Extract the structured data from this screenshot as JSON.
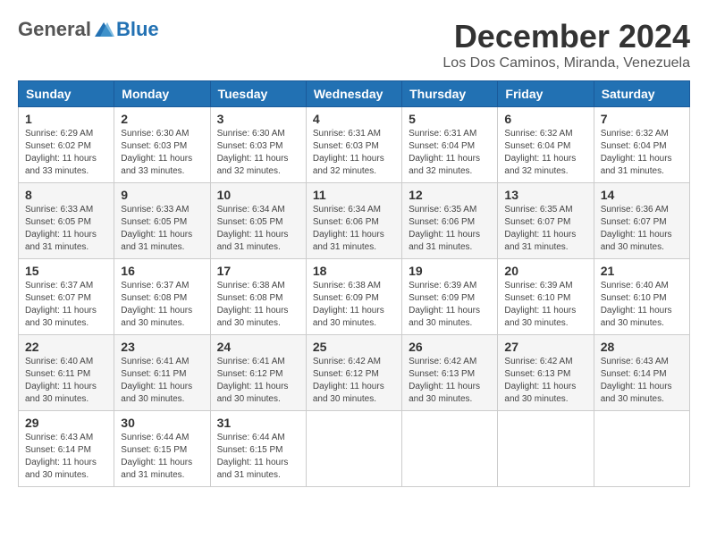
{
  "header": {
    "logo": {
      "general": "General",
      "blue": "Blue"
    },
    "title": "December 2024",
    "location": "Los Dos Caminos, Miranda, Venezuela"
  },
  "calendar": {
    "weekdays": [
      "Sunday",
      "Monday",
      "Tuesday",
      "Wednesday",
      "Thursday",
      "Friday",
      "Saturday"
    ],
    "weeks": [
      [
        {
          "day": "1",
          "sunrise": "6:29 AM",
          "sunset": "6:02 PM",
          "daylight": "11 hours and 33 minutes."
        },
        {
          "day": "2",
          "sunrise": "6:30 AM",
          "sunset": "6:03 PM",
          "daylight": "11 hours and 33 minutes."
        },
        {
          "day": "3",
          "sunrise": "6:30 AM",
          "sunset": "6:03 PM",
          "daylight": "11 hours and 32 minutes."
        },
        {
          "day": "4",
          "sunrise": "6:31 AM",
          "sunset": "6:03 PM",
          "daylight": "11 hours and 32 minutes."
        },
        {
          "day": "5",
          "sunrise": "6:31 AM",
          "sunset": "6:04 PM",
          "daylight": "11 hours and 32 minutes."
        },
        {
          "day": "6",
          "sunrise": "6:32 AM",
          "sunset": "6:04 PM",
          "daylight": "11 hours and 32 minutes."
        },
        {
          "day": "7",
          "sunrise": "6:32 AM",
          "sunset": "6:04 PM",
          "daylight": "11 hours and 31 minutes."
        }
      ],
      [
        {
          "day": "8",
          "sunrise": "6:33 AM",
          "sunset": "6:05 PM",
          "daylight": "11 hours and 31 minutes."
        },
        {
          "day": "9",
          "sunrise": "6:33 AM",
          "sunset": "6:05 PM",
          "daylight": "11 hours and 31 minutes."
        },
        {
          "day": "10",
          "sunrise": "6:34 AM",
          "sunset": "6:05 PM",
          "daylight": "11 hours and 31 minutes."
        },
        {
          "day": "11",
          "sunrise": "6:34 AM",
          "sunset": "6:06 PM",
          "daylight": "11 hours and 31 minutes."
        },
        {
          "day": "12",
          "sunrise": "6:35 AM",
          "sunset": "6:06 PM",
          "daylight": "11 hours and 31 minutes."
        },
        {
          "day": "13",
          "sunrise": "6:35 AM",
          "sunset": "6:07 PM",
          "daylight": "11 hours and 31 minutes."
        },
        {
          "day": "14",
          "sunrise": "6:36 AM",
          "sunset": "6:07 PM",
          "daylight": "11 hours and 30 minutes."
        }
      ],
      [
        {
          "day": "15",
          "sunrise": "6:37 AM",
          "sunset": "6:07 PM",
          "daylight": "11 hours and 30 minutes."
        },
        {
          "day": "16",
          "sunrise": "6:37 AM",
          "sunset": "6:08 PM",
          "daylight": "11 hours and 30 minutes."
        },
        {
          "day": "17",
          "sunrise": "6:38 AM",
          "sunset": "6:08 PM",
          "daylight": "11 hours and 30 minutes."
        },
        {
          "day": "18",
          "sunrise": "6:38 AM",
          "sunset": "6:09 PM",
          "daylight": "11 hours and 30 minutes."
        },
        {
          "day": "19",
          "sunrise": "6:39 AM",
          "sunset": "6:09 PM",
          "daylight": "11 hours and 30 minutes."
        },
        {
          "day": "20",
          "sunrise": "6:39 AM",
          "sunset": "6:10 PM",
          "daylight": "11 hours and 30 minutes."
        },
        {
          "day": "21",
          "sunrise": "6:40 AM",
          "sunset": "6:10 PM",
          "daylight": "11 hours and 30 minutes."
        }
      ],
      [
        {
          "day": "22",
          "sunrise": "6:40 AM",
          "sunset": "6:11 PM",
          "daylight": "11 hours and 30 minutes."
        },
        {
          "day": "23",
          "sunrise": "6:41 AM",
          "sunset": "6:11 PM",
          "daylight": "11 hours and 30 minutes."
        },
        {
          "day": "24",
          "sunrise": "6:41 AM",
          "sunset": "6:12 PM",
          "daylight": "11 hours and 30 minutes."
        },
        {
          "day": "25",
          "sunrise": "6:42 AM",
          "sunset": "6:12 PM",
          "daylight": "11 hours and 30 minutes."
        },
        {
          "day": "26",
          "sunrise": "6:42 AM",
          "sunset": "6:13 PM",
          "daylight": "11 hours and 30 minutes."
        },
        {
          "day": "27",
          "sunrise": "6:42 AM",
          "sunset": "6:13 PM",
          "daylight": "11 hours and 30 minutes."
        },
        {
          "day": "28",
          "sunrise": "6:43 AM",
          "sunset": "6:14 PM",
          "daylight": "11 hours and 30 minutes."
        }
      ],
      [
        {
          "day": "29",
          "sunrise": "6:43 AM",
          "sunset": "6:14 PM",
          "daylight": "11 hours and 30 minutes."
        },
        {
          "day": "30",
          "sunrise": "6:44 AM",
          "sunset": "6:15 PM",
          "daylight": "11 hours and 31 minutes."
        },
        {
          "day": "31",
          "sunrise": "6:44 AM",
          "sunset": "6:15 PM",
          "daylight": "11 hours and 31 minutes."
        },
        null,
        null,
        null,
        null
      ]
    ]
  }
}
